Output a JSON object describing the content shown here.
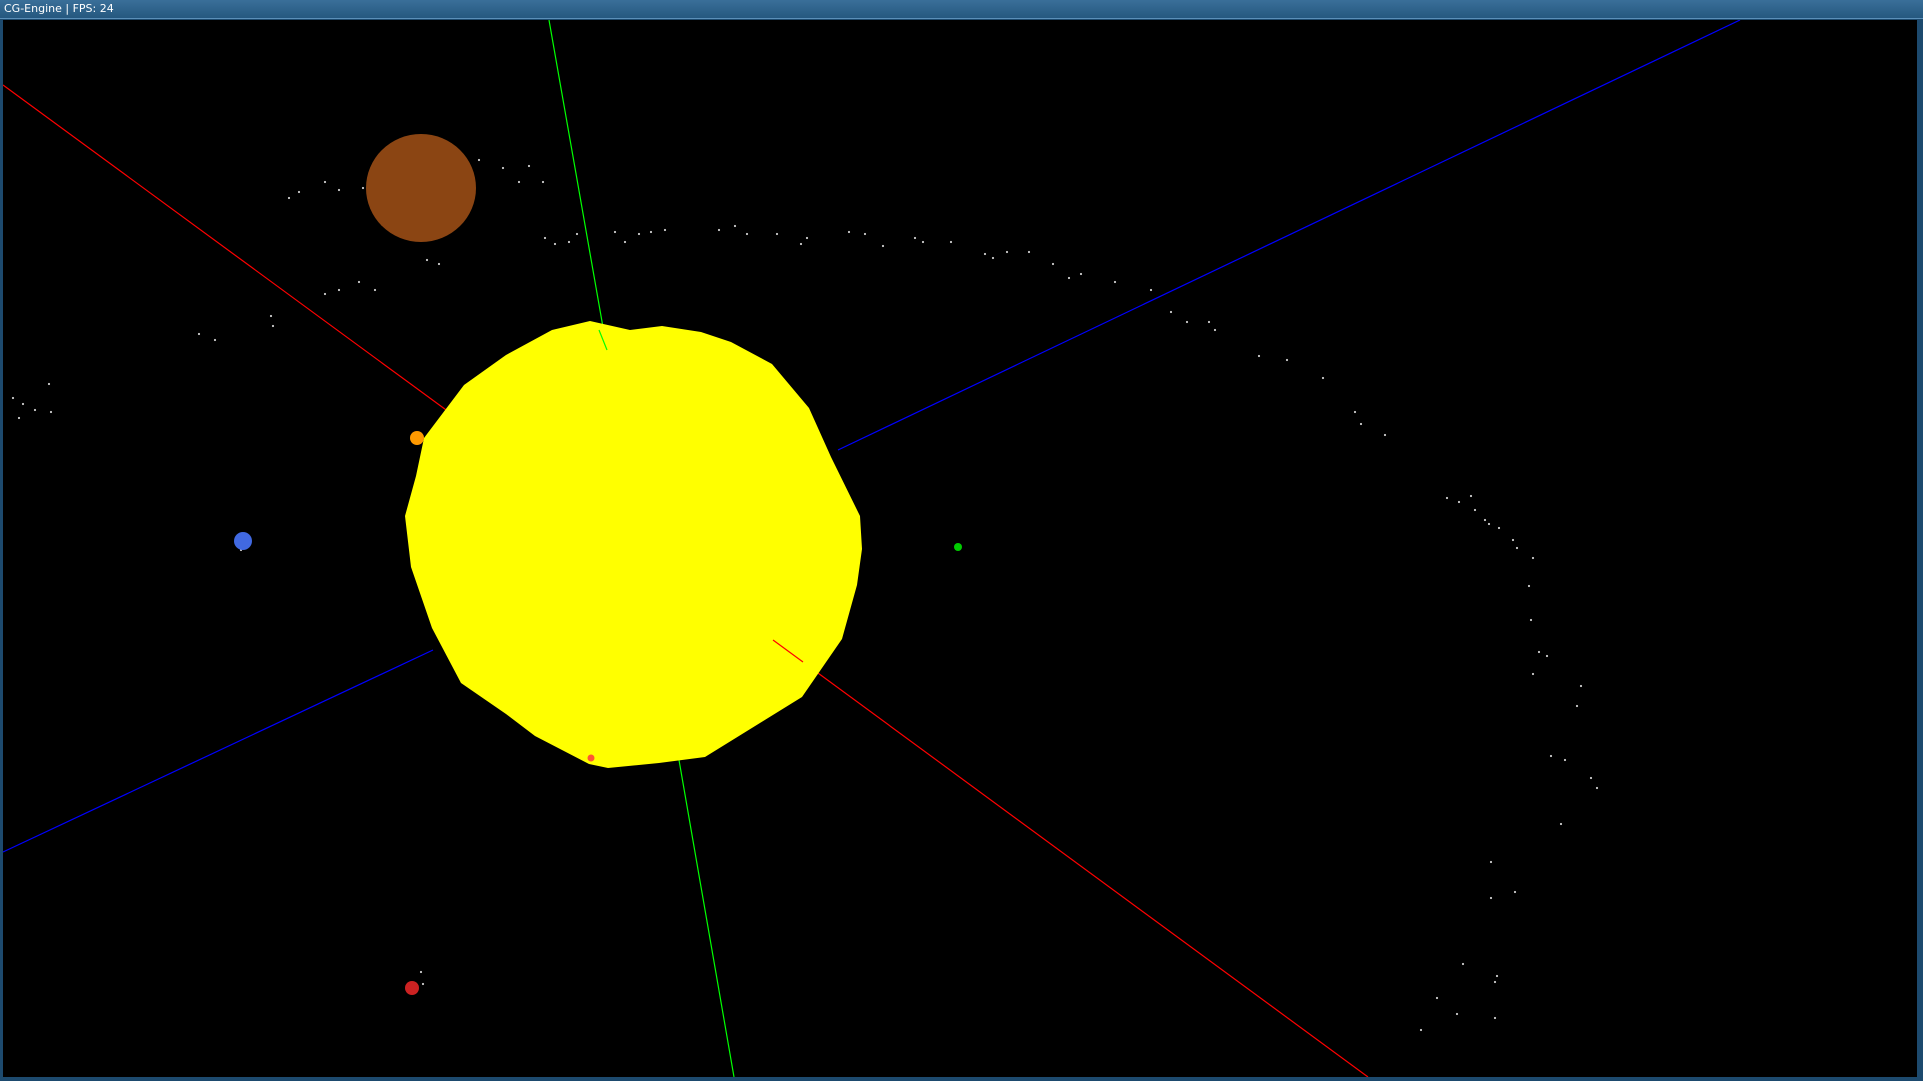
{
  "window": {
    "title": "CG-Engine | FPS: 24"
  },
  "scene": {
    "background": "#000000",
    "axis_colors": {
      "x": "#ff0000",
      "y": "#00ff00",
      "z": "#0000ff"
    },
    "sun": {
      "color": "#ffff00"
    },
    "planets": [
      {
        "name": "brown-planet-icon",
        "color": "#8b4513"
      },
      {
        "name": "orange-planet-icon",
        "color": "#ff9900"
      },
      {
        "name": "blue-planet-icon",
        "color": "#4169e1"
      },
      {
        "name": "green-planet-icon",
        "color": "#00cc00"
      },
      {
        "name": "red-planet-icon",
        "color": "#cc2222"
      },
      {
        "name": "red-orange-planet-icon",
        "color": "#ff5533"
      }
    ],
    "star_color": "#cccccc"
  }
}
